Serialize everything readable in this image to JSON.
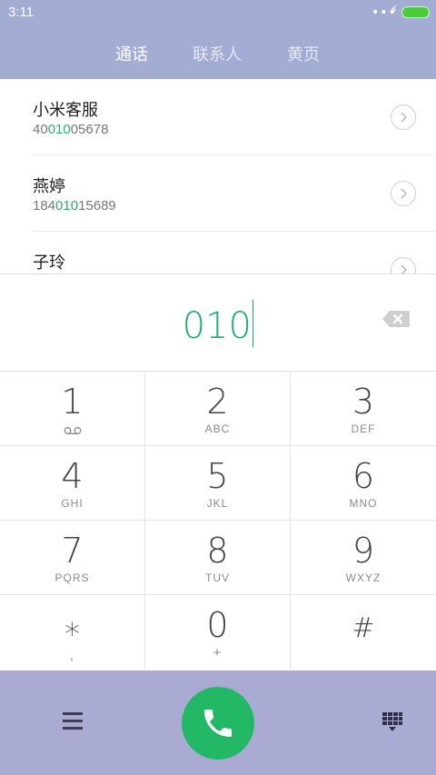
{
  "status": {
    "time": "3:11",
    "dots": "•••",
    "bolt": "⚡"
  },
  "tabs": [
    {
      "label": "通话",
      "active": true
    },
    {
      "label": "联系人",
      "active": false
    },
    {
      "label": "黄页",
      "active": false
    }
  ],
  "contacts": [
    {
      "name": "小米客服",
      "number_pre": "40",
      "number_match": "010",
      "number_post": "05678"
    },
    {
      "name": "燕婷",
      "number_pre": "184",
      "number_match": "010",
      "number_post": "15689"
    },
    {
      "name": "子玲",
      "number_pre": "",
      "number_match": "",
      "number_post": ""
    }
  ],
  "dialed": "010",
  "keys": [
    {
      "digit": "1",
      "sub": ""
    },
    {
      "digit": "2",
      "sub": "ABC"
    },
    {
      "digit": "3",
      "sub": "DEF"
    },
    {
      "digit": "4",
      "sub": "GHI"
    },
    {
      "digit": "5",
      "sub": "JKL"
    },
    {
      "digit": "6",
      "sub": "MNO"
    },
    {
      "digit": "7",
      "sub": "PQRS"
    },
    {
      "digit": "8",
      "sub": "TUV"
    },
    {
      "digit": "9",
      "sub": "WXYZ"
    },
    {
      "digit": "∗",
      "sub": ","
    },
    {
      "digit": "0",
      "sub": "+"
    },
    {
      "digit": "#",
      "sub": ""
    }
  ],
  "colors": {
    "header": "#a3add3",
    "bottom_bar": "#a9abd3",
    "accent_green": "#1fae72",
    "call_button": "#23b865"
  },
  "icons": {
    "voicemail": "voicemail-icon",
    "backspace": "backspace-icon",
    "menu": "menu-icon",
    "call": "phone-icon",
    "keypad": "dialpad-icon"
  }
}
